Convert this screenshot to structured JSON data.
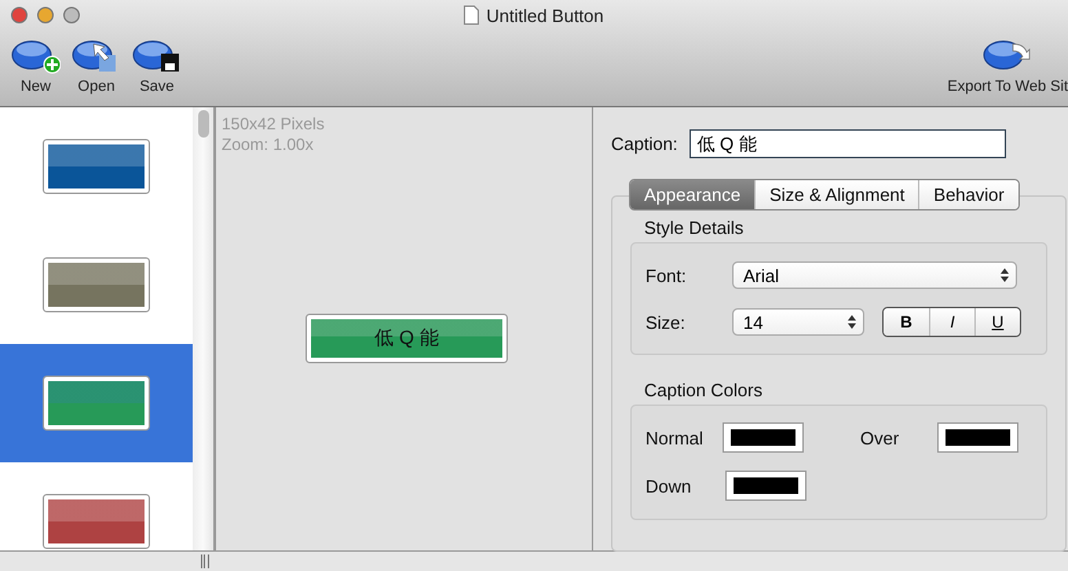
{
  "window": {
    "title": "Untitled Button"
  },
  "toolbar": {
    "items": [
      {
        "label": "New",
        "kind": "new"
      },
      {
        "label": "Open",
        "kind": "open"
      },
      {
        "label": "Save",
        "kind": "save"
      }
    ],
    "export": {
      "label": "Export To Web Sit",
      "kind": "export"
    }
  },
  "styles": [
    {
      "color": "#0a5599",
      "selected": false
    },
    {
      "color": "#76745f",
      "selected": false
    },
    {
      "color": "#279a58",
      "selected": true
    },
    {
      "color": "#ae4242",
      "selected": false
    }
  ],
  "canvas": {
    "size": "150x42 Pixels",
    "zoom": "Zoom: 1.00x",
    "button_caption": "低 Q 能"
  },
  "caption": {
    "label": "Caption:",
    "value": "低 Q 能"
  },
  "tabs": [
    {
      "label": "Appearance",
      "selected": true
    },
    {
      "label": "Size & Alignment",
      "selected": false
    },
    {
      "label": "Behavior",
      "selected": false
    }
  ],
  "style_details": {
    "title": "Style Details",
    "font_label": "Font:",
    "font": "Arial",
    "size_label": "Size:",
    "size": "14",
    "format": [
      {
        "label": "B",
        "kind": "bold",
        "on": false
      },
      {
        "label": "I",
        "kind": "italic",
        "on": false
      },
      {
        "label": "U",
        "kind": "underline",
        "on": false
      }
    ]
  },
  "caption_colors": {
    "title": "Caption Colors",
    "wells": [
      {
        "label": "Normal",
        "color": "#000000"
      },
      {
        "label": "Over",
        "color": "#000000"
      },
      {
        "label": "Down",
        "color": "#000000"
      }
    ]
  }
}
